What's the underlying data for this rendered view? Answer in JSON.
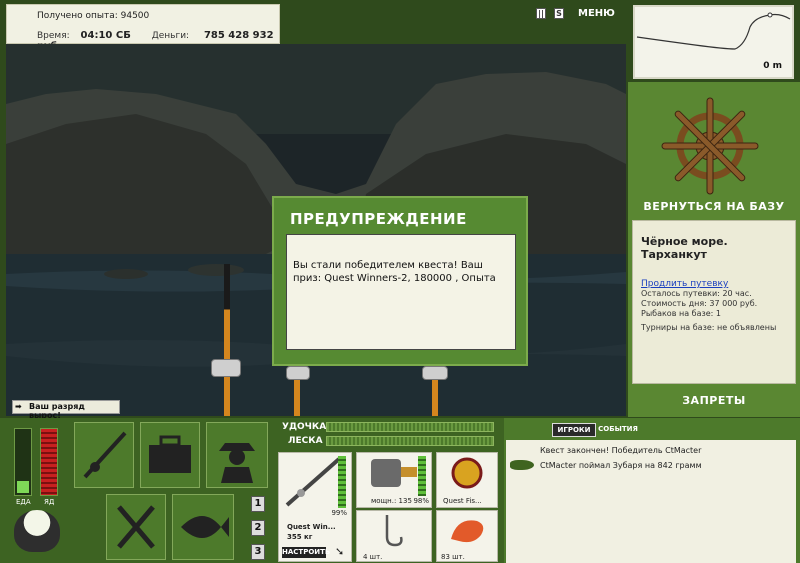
{
  "top_info": {
    "exp_label": "Получено опыта:",
    "exp_value": "94500",
    "time_label": "Время:",
    "time_value": "04:10 СБ",
    "money_label": "Деньги:",
    "money_value": "785 428 932 руб."
  },
  "top_menu": {
    "pause_icon": "pause-icon",
    "sound_icon": "sound-icon",
    "menu_label": "МЕНЮ"
  },
  "depth": {
    "value": "0 m"
  },
  "right_panel": {
    "return_label": "ВЕРНУТЬСЯ НА БАЗУ",
    "location_title": "Чёрное море. Тарханкут",
    "extend_link": "Продлить путевку",
    "trip_left": "Осталось путевки: 20 час.",
    "day_cost": "Стоимость дня: 37 000 руб.",
    "fishers": "Рыбаков на базе: 1",
    "tournaments": "Турниры на базе: не объявлены",
    "bans_label": "ЗАПРЕТЫ"
  },
  "dialog": {
    "title": "ПРЕДУПРЕЖДЕНИЕ",
    "message": "Вы стали победителем квеста! Ваш приз: Quest Winners-2, 180000 , Опыта"
  },
  "rank": {
    "text": "Ваш разряд вырос!"
  },
  "status": {
    "food_label": "ЕДА",
    "poison_label": "ЯД"
  },
  "tackle": {
    "rod_label": "УДОЧКА",
    "line_label": "ЛЕСКА",
    "rod_name": "Quest Win...",
    "rod_weight": "355 кг",
    "rod_percent": "99%",
    "setup_label": "НАСТРОИТЬ",
    "reel_power": "мощн.: 135",
    "reel_percent": "98%",
    "line_name": "Quest Fis...",
    "hook_count": "4 шт.",
    "bait_count": "83 шт."
  },
  "slots": {
    "numbers": [
      "1",
      "2",
      "3"
    ]
  },
  "chat": {
    "tab_players": "ИГРОКИ",
    "tab_events": "СОБЫТИЯ",
    "line1": "Квест закончен! Победитель CtMacter",
    "line2": "CtMacter поймал Зубаря на 842 грамм"
  },
  "colors": {
    "panel_green": "#4f7a2c",
    "accent_light": "#7da24a",
    "info_bg": "#f1f1e3"
  }
}
